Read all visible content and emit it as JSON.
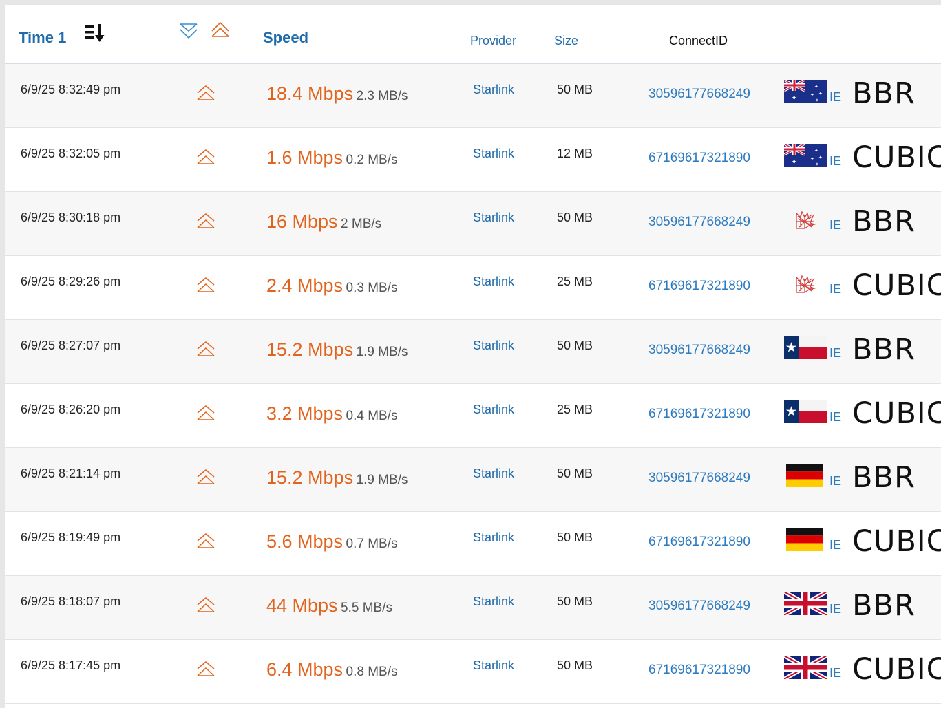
{
  "header": {
    "time_label": "Time 1",
    "sort_icon": "sort-descending-icon",
    "direction_icons": [
      "download-arrow-icon",
      "upload-arrow-icon"
    ],
    "speed_label": "Speed",
    "provider_label": "Provider",
    "size_label": "Size",
    "connect_label": "ConnectID"
  },
  "colors": {
    "header_blue": "#1f6bab",
    "speed_orange": "#e2641c",
    "link_blue": "#2d7bbf"
  },
  "rows": [
    {
      "time": "6/9/25 8:32:49 pm",
      "direction_icon": "upload-arrow-icon",
      "mbps": "18.4 Mbps",
      "mbs": "2.3 MB/s",
      "provider": "Starlink",
      "size": "50 MB",
      "connect_id": "30596177668249",
      "flag": "australia-flag-icon",
      "cc": "IE",
      "algo": "BBR"
    },
    {
      "time": "6/9/25 8:32:05 pm",
      "direction_icon": "upload-arrow-icon",
      "mbps": "1.6 Mbps",
      "mbs": "0.2 MB/s",
      "provider": "Starlink",
      "size": "12 MB",
      "connect_id": "67169617321890",
      "flag": "australia-flag-icon",
      "cc": "IE",
      "algo": "CUBIC"
    },
    {
      "time": "6/9/25 8:30:18 pm",
      "direction_icon": "upload-arrow-icon",
      "mbps": "16 Mbps",
      "mbs": "2 MB/s",
      "provider": "Starlink",
      "size": "50 MB",
      "connect_id": "30596177668249",
      "flag": "red-emblem-icon",
      "cc": "IE",
      "algo": "BBR"
    },
    {
      "time": "6/9/25 8:29:26 pm",
      "direction_icon": "upload-arrow-icon",
      "mbps": "2.4 Mbps",
      "mbs": "0.3 MB/s",
      "provider": "Starlink",
      "size": "25 MB",
      "connect_id": "67169617321890",
      "flag": "red-emblem-icon",
      "cc": "IE",
      "algo": "CUBIC"
    },
    {
      "time": "6/9/25 8:27:07 pm",
      "direction_icon": "upload-arrow-icon",
      "mbps": "15.2 Mbps",
      "mbs": "1.9 MB/s",
      "provider": "Starlink",
      "size": "50 MB",
      "connect_id": "30596177668249",
      "flag": "texas-flag-icon",
      "cc": "IE",
      "algo": "BBR"
    },
    {
      "time": "6/9/25 8:26:20 pm",
      "direction_icon": "upload-arrow-icon",
      "mbps": "3.2 Mbps",
      "mbs": "0.4 MB/s",
      "provider": "Starlink",
      "size": "25 MB",
      "connect_id": "67169617321890",
      "flag": "texas-flag-icon",
      "cc": "IE",
      "algo": "CUBIC"
    },
    {
      "time": "6/9/25 8:21:14 pm",
      "direction_icon": "upload-arrow-icon",
      "mbps": "15.2 Mbps",
      "mbs": "1.9 MB/s",
      "provider": "Starlink",
      "size": "50 MB",
      "connect_id": "30596177668249",
      "flag": "germany-flag-icon",
      "cc": "IE",
      "algo": "BBR"
    },
    {
      "time": "6/9/25 8:19:49 pm",
      "direction_icon": "upload-arrow-icon",
      "mbps": "5.6 Mbps",
      "mbs": "0.7 MB/s",
      "provider": "Starlink",
      "size": "50 MB",
      "connect_id": "67169617321890",
      "flag": "germany-flag-icon",
      "cc": "IE",
      "algo": "CUBIC"
    },
    {
      "time": "6/9/25 8:18:07 pm",
      "direction_icon": "upload-arrow-icon",
      "mbps": "44 Mbps",
      "mbs": "5.5 MB/s",
      "provider": "Starlink",
      "size": "50 MB",
      "connect_id": "30596177668249",
      "flag": "uk-flag-icon",
      "cc": "IE",
      "algo": "BBR"
    },
    {
      "time": "6/9/25 8:17:45 pm",
      "direction_icon": "upload-arrow-icon",
      "mbps": "6.4 Mbps",
      "mbs": "0.8 MB/s",
      "provider": "Starlink",
      "size": "50 MB",
      "connect_id": "67169617321890",
      "flag": "uk-flag-icon",
      "cc": "IE",
      "algo": "CUBIC"
    }
  ]
}
